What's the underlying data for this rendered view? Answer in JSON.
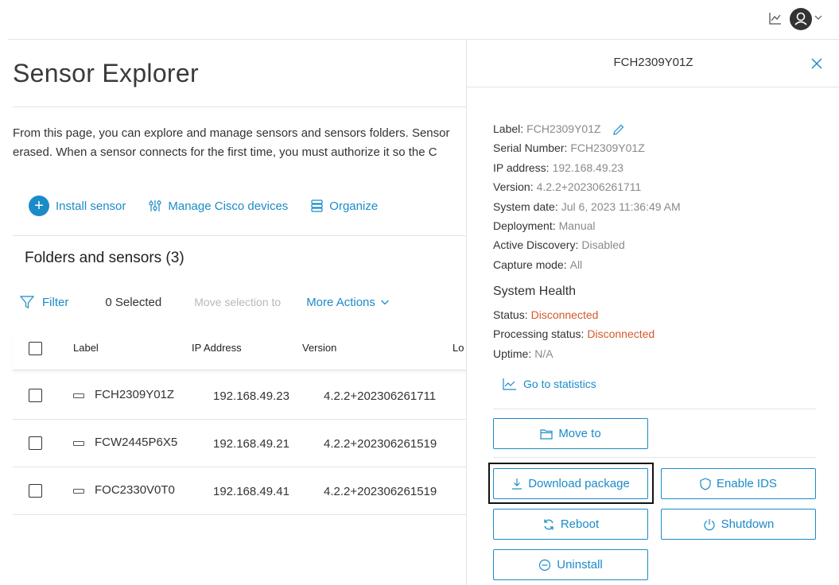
{
  "main": {
    "title": "Sensor Explorer",
    "description_line1": "From this page, you can explore and manage sensors and sensors folders. Sensor",
    "description_line2": "erased. When a sensor connects for the first time, you must authorize it so the C",
    "actions": {
      "install": "Install sensor",
      "manage": "Manage Cisco devices",
      "organize": "Organize"
    },
    "section_title": "Folders and sensors (3)",
    "toolbar": {
      "filter": "Filter",
      "selected": "0 Selected",
      "move_selection": "Move selection to",
      "more_actions": "More Actions"
    },
    "table": {
      "columns": [
        "Label",
        "IP Address",
        "Version",
        "Lo"
      ],
      "rows": [
        {
          "label": "FCH2309Y01Z",
          "ip": "192.168.49.23",
          "version": "4.2.2+202306261711"
        },
        {
          "label": "FCW2445P6X5",
          "ip": "192.168.49.21",
          "version": "4.2.2+202306261519"
        },
        {
          "label": "FOC2330V0T0",
          "ip": "192.168.49.41",
          "version": "4.2.2+202306261519"
        }
      ]
    }
  },
  "panel": {
    "title": "FCH2309Y01Z",
    "info": {
      "label_k": "Label:",
      "label_v": "FCH2309Y01Z",
      "serial_k": "Serial Number:",
      "serial_v": "FCH2309Y01Z",
      "ip_k": "IP address:",
      "ip_v": "192.168.49.23",
      "version_k": "Version:",
      "version_v": "4.2.2+202306261711",
      "date_k": "System date:",
      "date_v": "Jul 6, 2023 11:36:49 AM",
      "deploy_k": "Deployment:",
      "deploy_v": "Manual",
      "discovery_k": "Active Discovery:",
      "discovery_v": "Disabled",
      "capture_k": "Capture mode:",
      "capture_v": "All"
    },
    "health": {
      "title": "System Health",
      "status_k": "Status:",
      "status_v": "Disconnected",
      "processing_k": "Processing status:",
      "processing_v": "Disconnected",
      "uptime_k": "Uptime:",
      "uptime_v": "N/A"
    },
    "go_to_statistics": "Go to statistics",
    "buttons": {
      "move_to": "Move to",
      "download": "Download package",
      "enable_ids": "Enable IDS",
      "reboot": "Reboot",
      "shutdown": "Shutdown",
      "uninstall": "Uninstall"
    }
  },
  "colors": {
    "accent": "#1b8bc8",
    "error": "#d5582e"
  },
  "icons": [
    "stats-icon",
    "user-icon",
    "chevron-down-icon",
    "plus-icon",
    "devices-icon",
    "organize-icon",
    "filter-icon",
    "sensor-icon",
    "close-icon",
    "pencil-icon",
    "folder-icon",
    "download-icon",
    "shield-icon",
    "refresh-icon",
    "power-icon",
    "minus-circle-icon"
  ]
}
